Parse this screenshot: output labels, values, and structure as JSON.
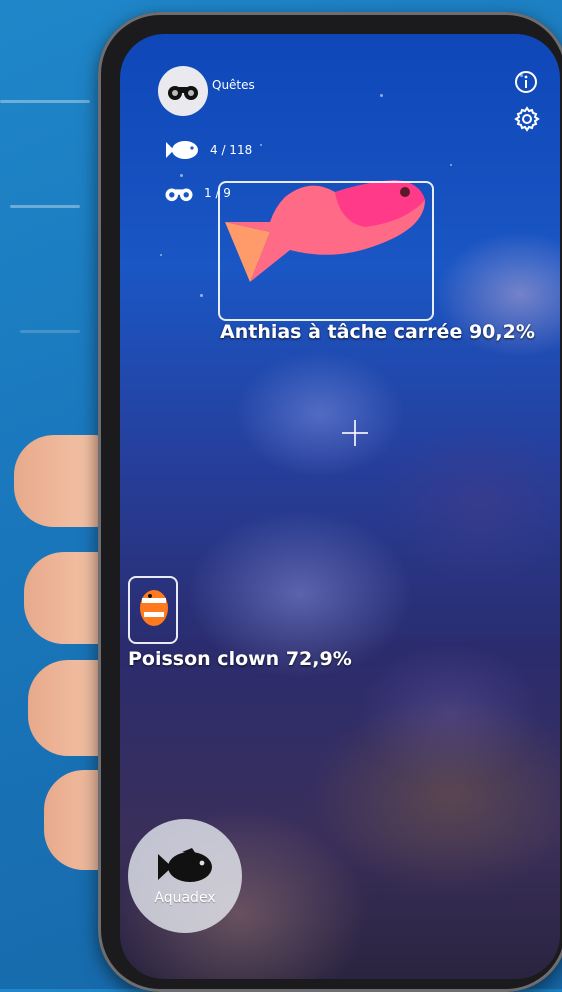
{
  "header": {
    "quests_label": "Quêtes"
  },
  "stats": {
    "fish_count": "4 / 118",
    "quest_count": "1 / 9"
  },
  "detections": [
    {
      "label": "Anthias à tâche carrée 90,2%"
    },
    {
      "label": "Poisson clown 72,9%"
    }
  ],
  "bottom": {
    "aquadex_label": "Aquadex"
  },
  "icons": {
    "quests": "binoculars-icon",
    "fish": "fish-icon",
    "info": "info-icon",
    "settings": "gear-icon",
    "crosshair": "crosshair-icon"
  }
}
